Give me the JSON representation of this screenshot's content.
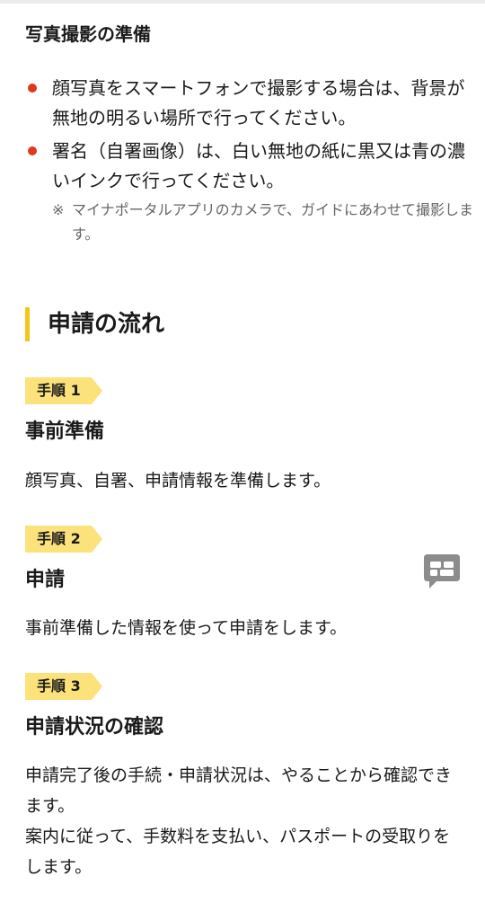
{
  "photo_section": {
    "title": "写真撮影の準備",
    "bullets": [
      "顔写真をスマートフォンで撮影する場合は、背景が無地の明るい場所で行ってください。",
      "署名（自署画像）は、白い無地の紙に黒又は青の濃いインクで行ってください。"
    ],
    "note_mark": "※",
    "note": "マイナポータルアプリのカメラで、ガイドにあわせて撮影します。"
  },
  "flow": {
    "heading": "申請の流れ",
    "steps": [
      {
        "tag": "手順 1",
        "title": "事前準備",
        "body": "顔写真、自署、申請情報を準備します。"
      },
      {
        "tag": "手順 2",
        "title": "申請",
        "body": "事前準備した情報を使って申請をします。"
      },
      {
        "tag": "手順 3",
        "title": "申請状況の確認",
        "body_line1": "申請完了後の手続・申請状況は、やることから確認できます。",
        "body_line2": "案内に従って、手数料を支払い、パスポートの受取りをします。"
      }
    ]
  },
  "chat_button": {
    "icon": "chat-bubble-icon"
  },
  "colors": {
    "bullet_dot": "#e0371d",
    "accent_yellow": "#f5c518",
    "tag_yellow": "#fbe27a",
    "note_gray": "#666666"
  }
}
